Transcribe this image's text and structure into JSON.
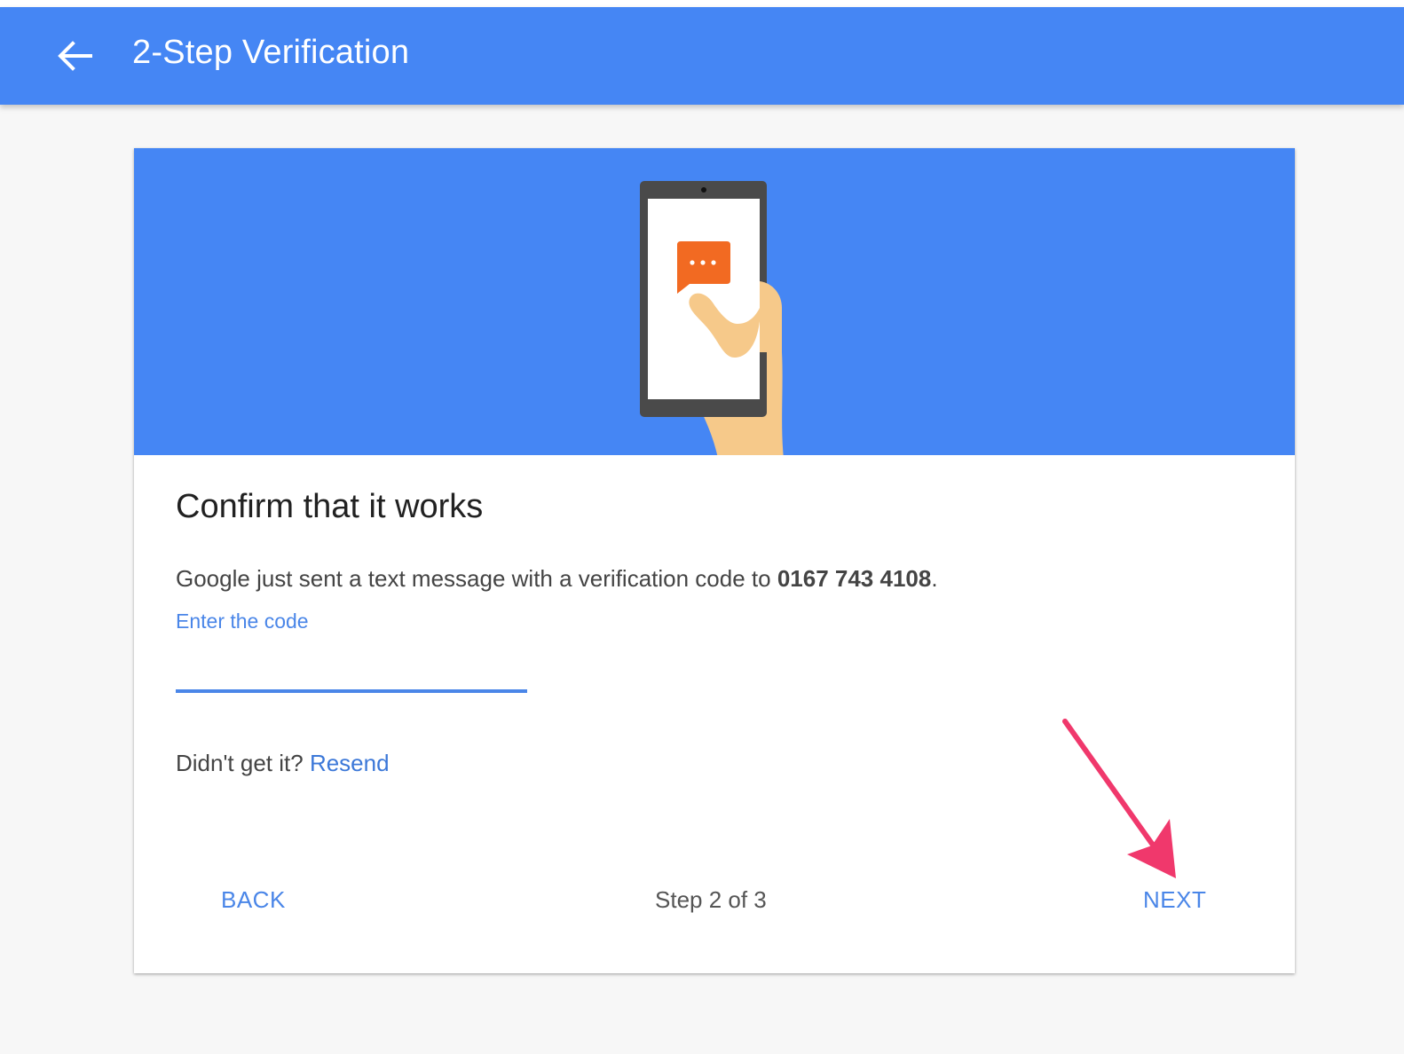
{
  "header": {
    "title": "2-Step Verification",
    "back_icon": "arrow-left-icon"
  },
  "card": {
    "heading": "Confirm that it works",
    "description_prefix": "Google just sent a text message with a verification code to ",
    "phone_number": "0167 743 4108",
    "description_suffix": ".",
    "code_label": "Enter the code",
    "code_value": "",
    "resend_prompt": "Didn't get it? ",
    "resend_link": "Resend",
    "back_button": "BACK",
    "step_indicator": "Step 2 of 3",
    "next_button": "NEXT"
  },
  "colors": {
    "primary": "#4586f4",
    "link": "#4a86e8",
    "message_bubble": "#f26a22",
    "annotation_arrow": "#f0386c"
  }
}
